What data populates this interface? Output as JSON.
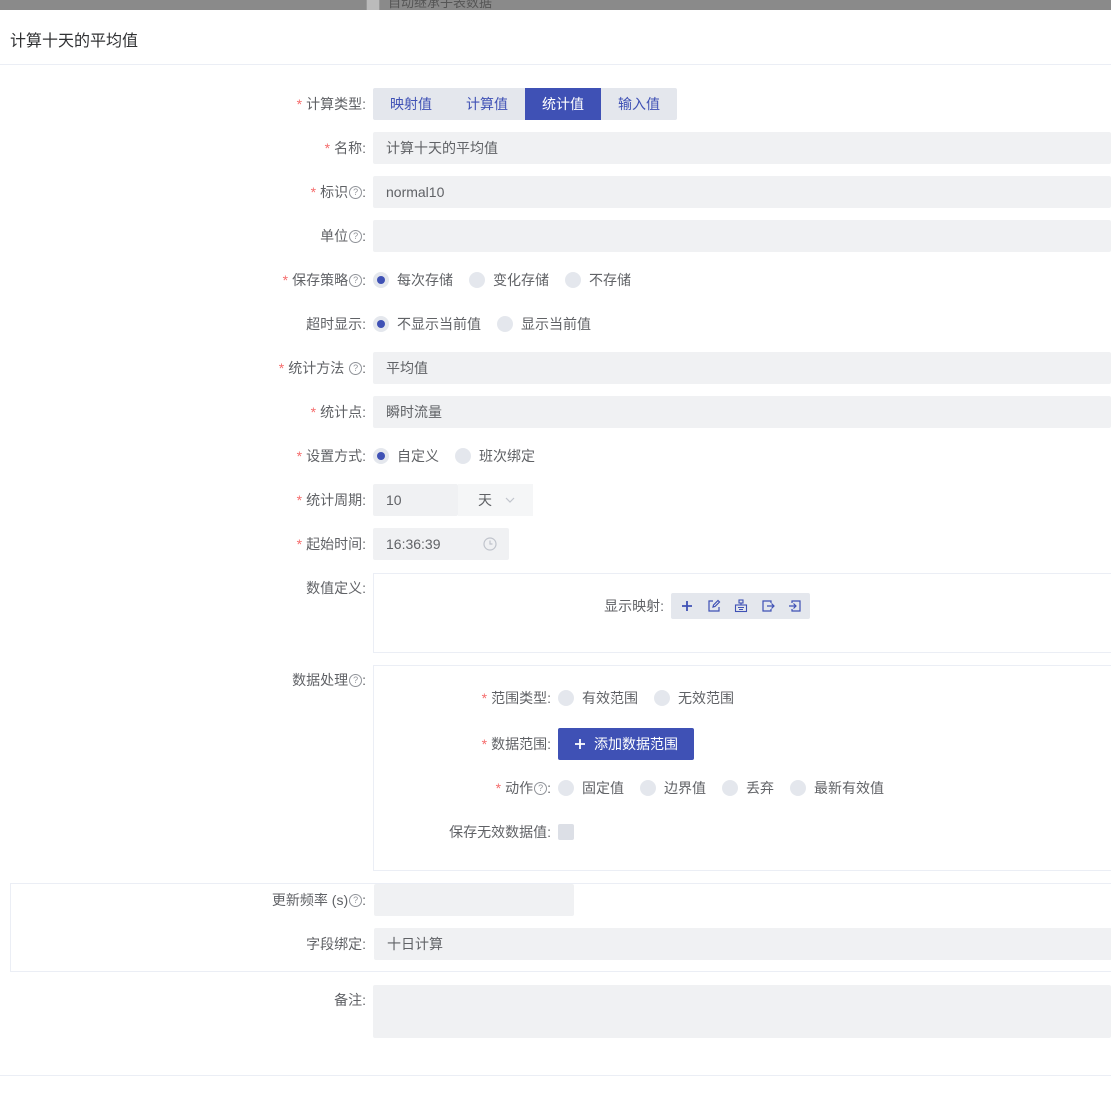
{
  "background": {
    "partial_text": "自动继承子表数据"
  },
  "dialog": {
    "title": "计算十天的平均值"
  },
  "form": {
    "calc_type": {
      "label": "计算类型:",
      "options": [
        "映射值",
        "计算值",
        "统计值",
        "输入值"
      ],
      "selected": "统计值"
    },
    "name": {
      "label": "名称:",
      "value": "计算十天的平均值"
    },
    "identifier": {
      "label": "标识",
      "value": "normal10"
    },
    "unit": {
      "label": "单位",
      "value": ""
    },
    "save_strategy": {
      "label": "保存策略",
      "options": [
        "每次存储",
        "变化存储",
        "不存储"
      ],
      "selected": "每次存储"
    },
    "timeout_display": {
      "label": "超时显示:",
      "options": [
        "不显示当前值",
        "显示当前值"
      ],
      "selected": "不显示当前值"
    },
    "stat_method": {
      "label": "统计方法",
      "value": "平均值"
    },
    "stat_point": {
      "label": "统计点:",
      "value": "瞬时流量"
    },
    "setting_mode": {
      "label": "设置方式:",
      "options": [
        "自定义",
        "班次绑定"
      ],
      "selected": "自定义"
    },
    "stat_period": {
      "label": "统计周期:",
      "value": "10",
      "unit": "天"
    },
    "start_time": {
      "label": "起始时间:",
      "value": "16:36:39"
    },
    "value_def": {
      "label": "数值定义:",
      "display_mapping_label": "显示映射:",
      "icons": [
        "plus-icon",
        "edit-icon",
        "hierarchy-icon",
        "export-icon",
        "import-icon"
      ]
    },
    "data_processing": {
      "label": "数据处理",
      "range_type": {
        "label": "范围类型:",
        "options": [
          "有效范围",
          "无效范围"
        ]
      },
      "data_range": {
        "label": "数据范围:",
        "button": "添加数据范围"
      },
      "action": {
        "label": "动作",
        "options": [
          "固定值",
          "边界值",
          "丢弃",
          "最新有效值"
        ]
      },
      "save_invalid": {
        "label": "保存无效数据值:"
      }
    },
    "update_freq": {
      "label": "更新频率 (s)",
      "value": ""
    },
    "field_binding": {
      "label": "字段绑定:",
      "value": "十日计算"
    },
    "remark": {
      "label": "备注:",
      "value": ""
    }
  },
  "colors": {
    "primary": "#3f51b5",
    "required": "#f56c6c",
    "input_bg": "#f0f1f3"
  }
}
